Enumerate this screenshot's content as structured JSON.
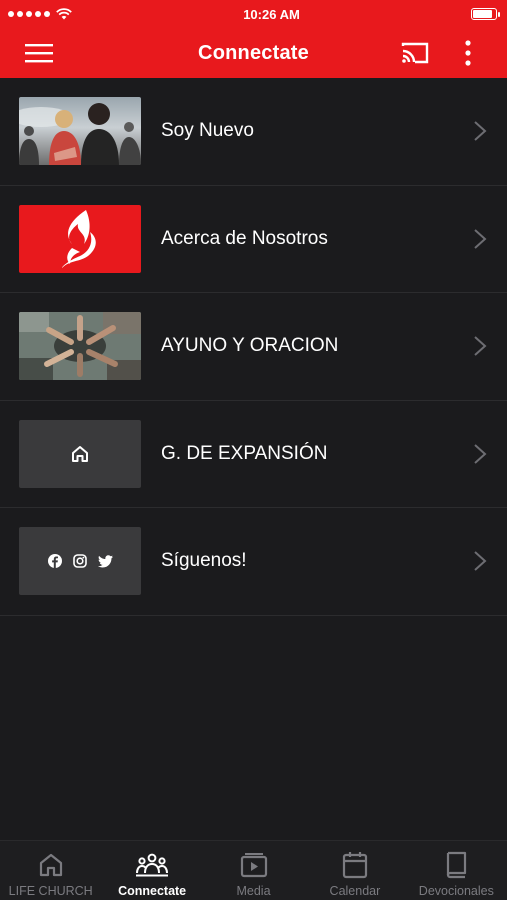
{
  "status_bar": {
    "time": "10:26 AM"
  },
  "app_bar": {
    "title": "Connectate",
    "menu_icon": "hamburger-icon",
    "cast_icon": "cast-icon",
    "more_icon": "more-vertical-icon"
  },
  "list": {
    "items": [
      {
        "label": "Soy Nuevo",
        "thumb": "photo-people"
      },
      {
        "label": "Acerca de Nosotros",
        "thumb": "flame-logo"
      },
      {
        "label": "AYUNO Y ORACION",
        "thumb": "photo-prayer"
      },
      {
        "label": "G. DE EXPANSIÓN",
        "thumb": "home-icon"
      },
      {
        "label": "Síguenos!",
        "thumb": "social-icons"
      }
    ]
  },
  "tabs": [
    {
      "label": "LIFE CHURCH",
      "icon": "home-icon",
      "active": false
    },
    {
      "label": "Connectate",
      "icon": "group-icon",
      "active": true
    },
    {
      "label": "Media",
      "icon": "media-play-icon",
      "active": false
    },
    {
      "label": "Calendar",
      "icon": "calendar-icon",
      "active": false
    },
    {
      "label": "Devocionales",
      "icon": "book-icon",
      "active": false
    }
  ],
  "colors": {
    "accent": "#e8191d",
    "background": "#1b1b1d",
    "text": "#ffffff",
    "inactive": "#7b7b80"
  }
}
